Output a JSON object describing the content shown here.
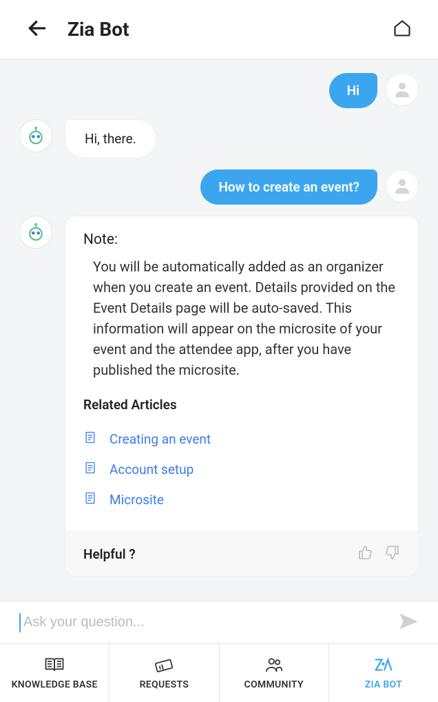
{
  "header": {
    "title": "Zia Bot"
  },
  "messages": {
    "user1": "Hi",
    "bot1": "Hi, there.",
    "user2": "How to create an event?"
  },
  "note": {
    "title": "Note:",
    "body": "You will be automatically added as an organizer when you create an event. Details provided on the Event Details page will be auto-saved. This information will appear on the microsite of your event and the attendee app, after you have published the microsite.",
    "relatedTitle": "Related Articles",
    "articles": [
      "Creating an event",
      "Account setup",
      "Microsite"
    ],
    "helpful": "Helpful ?"
  },
  "input": {
    "placeholder": "Ask your question..."
  },
  "nav": {
    "kb": "KNOWLEDGE BASE",
    "req": "REQUESTS",
    "com": "COMMUNITY",
    "zia": "ZIA BOT"
  }
}
